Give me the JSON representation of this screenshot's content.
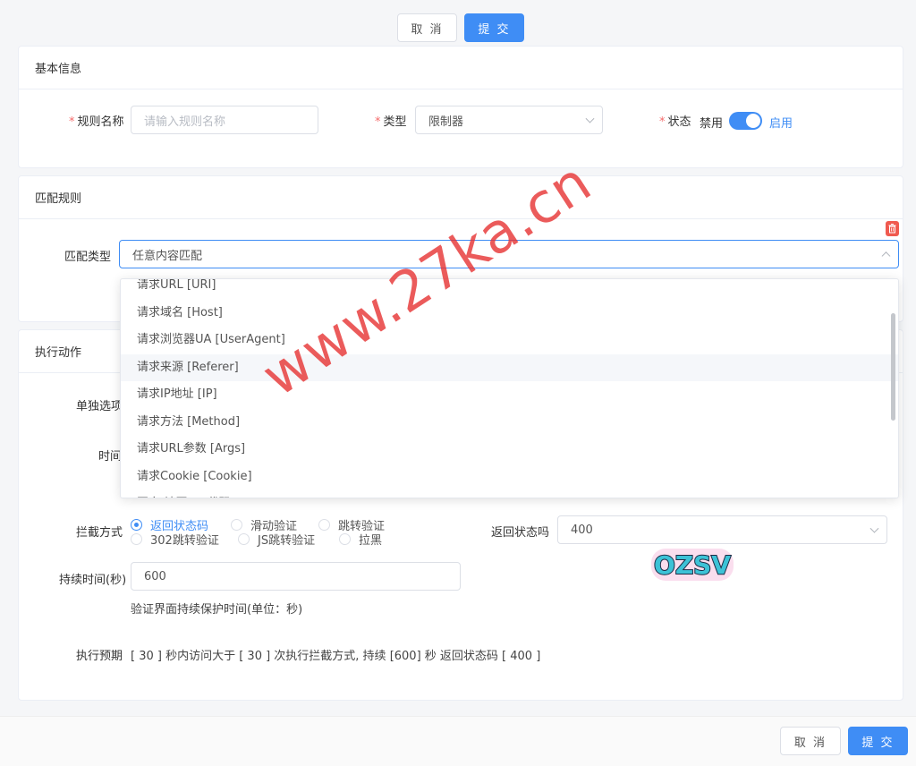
{
  "top_actions": {
    "cancel": "取 消",
    "submit": "提 交"
  },
  "bottom_actions": {
    "cancel": "取 消",
    "submit": "提 交"
  },
  "basic_info": {
    "title": "基本信息",
    "rule_name": {
      "label": "规则名称",
      "placeholder": "请输入规则名称"
    },
    "type": {
      "label": "类型",
      "value": "限制器"
    },
    "status": {
      "label": "状态",
      "off": "禁用",
      "on": "启用",
      "enabled": true
    }
  },
  "match_rules": {
    "title": "匹配规则",
    "match_type": {
      "label": "匹配类型",
      "value": "任意内容匹配"
    },
    "options": [
      "请求URL [URI]",
      "请求域名 [Host]",
      "请求浏览器UA [UserAgent]",
      "请求来源 [Referer]",
      "请求IP地址 [IP]",
      "请求方法 [Method]",
      "请求URL参数 [Args]",
      "请求Cookie [Cookie]",
      "国家/地区ISO代码 [ISO-CODE]"
    ],
    "hovered_index": 3
  },
  "actions": {
    "title": "执行动作",
    "single_option_label": "单独选项",
    "time_label": "时间",
    "intercept": {
      "label": "拦截方式",
      "options": [
        "返回状态码",
        "滑动验证",
        "跳转验证",
        "302跳转验证",
        "JS跳转验证",
        "拉黑"
      ],
      "selected": 0
    },
    "return_status": {
      "label": "返回状态吗",
      "value": "400"
    },
    "duration": {
      "label": "持续时间(秒)",
      "value": "600",
      "hint": "验证界面持续保护时间(单位：秒)"
    },
    "expected": {
      "label": "执行预期",
      "text": "[ 30 ] 秒内访问大于 [ 30 ] 次执行拦截方式, 持续 [600] 秒 返回状态码 [ 400 ]"
    }
  },
  "overlay": {
    "watermark": "www.27ka.cn",
    "sticker": "OZSV"
  },
  "colors": {
    "primary": "#3f8df5",
    "danger": "#f56c6c",
    "delete": "#f05a4f"
  }
}
